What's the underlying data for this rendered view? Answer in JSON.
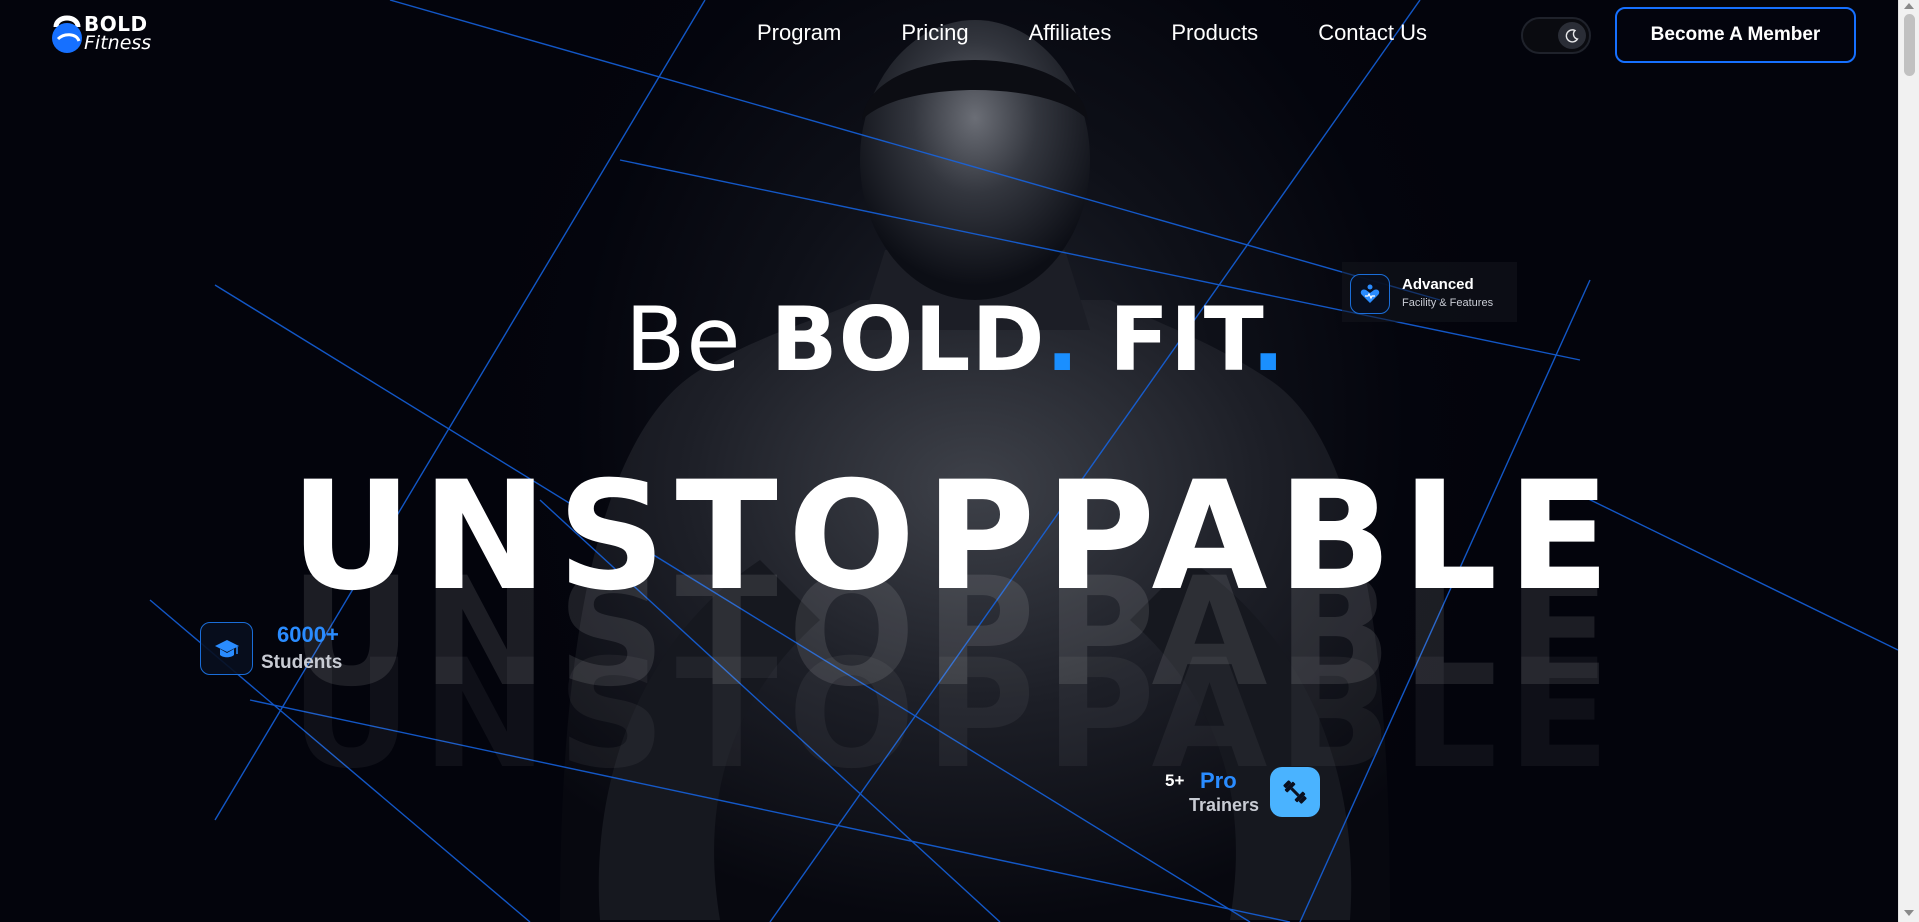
{
  "brand": {
    "logo_line1": "BOLD",
    "logo_line2": "Fitness",
    "accent_color": "#1a8fff",
    "logo_icon": "kettlebell-icon"
  },
  "nav": {
    "links": [
      {
        "label": "Program"
      },
      {
        "label": "Pricing"
      },
      {
        "label": "Affiliates"
      },
      {
        "label": "Products"
      },
      {
        "label": "Contact Us"
      }
    ],
    "theme_toggle": {
      "state": "dark",
      "icon": "moon-icon"
    },
    "cta_label": "Become A Member"
  },
  "hero": {
    "headline": {
      "be": "Be",
      "bold": "BOLD",
      "fit": "FIT",
      "dot": "."
    },
    "big_word": "UNSTOPPABLE"
  },
  "stats": {
    "advanced": {
      "title": "Advanced",
      "subtitle": "Facility & Features",
      "icon": "heart-person-icon"
    },
    "students": {
      "count": "6000+",
      "label": "Students",
      "icon": "graduation-cap-icon"
    },
    "trainers": {
      "count": "5+",
      "highlight": "Pro",
      "label": "Trainers",
      "icon": "dumbbell-icon"
    }
  },
  "colors": {
    "background": "#03040c",
    "accent": "#1a8fff",
    "trainer_icon_bg": "#4ab3ff"
  }
}
